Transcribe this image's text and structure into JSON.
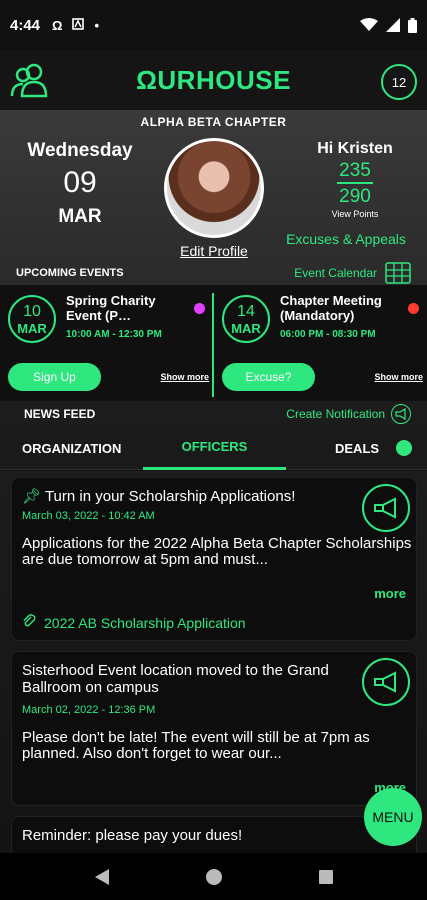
{
  "status_bar": {
    "time": "4:44",
    "icons": [
      "omega-icon",
      "nfc-icon",
      "dot-icon",
      "wifi-icon",
      "signal-icon",
      "battery-icon"
    ]
  },
  "header": {
    "logo": "ΩURHOUSE",
    "notification_count": "12"
  },
  "hero": {
    "chapter_name": "ALPHA BETA CHAPTER",
    "day_name": "Wednesday",
    "day_number": "09",
    "month": "MAR",
    "edit_profile": "Edit Profile",
    "greeting": "Hi Kristen",
    "points_earned": "235",
    "points_total": "290",
    "view_points": "View Points",
    "excuses_link": "Excuses & Appeals",
    "upcoming_title": "UPCOMING EVENTS",
    "event_calendar": "Event Calendar"
  },
  "events": [
    {
      "day": "10",
      "month": "MAR",
      "title": "Spring Charity Event (P…",
      "time": "10:00 AM - 12:30 PM",
      "dot_color": "#e040fb",
      "button": "Sign Up",
      "show_more": "Show more"
    },
    {
      "day": "14",
      "month": "MAR",
      "title": "Chapter Meeting (Mandatory)",
      "time": "06:00 PM - 08:30 PM",
      "dot_color": "#ff3b30",
      "button": "Excuse?",
      "show_more": "Show more"
    }
  ],
  "news": {
    "title": "NEWS FEED",
    "create_notification": "Create Notification"
  },
  "tabs": [
    {
      "label": "ORGANIZATION",
      "active": false
    },
    {
      "label": "OFFICERS",
      "active": true
    },
    {
      "label": "DEALS",
      "active": false
    }
  ],
  "posts": [
    {
      "title": "Turn in your Scholarship Applications!",
      "pinned": true,
      "date": "March 03, 2022 - 10:42 AM",
      "body": "Applications for the 2022 Alpha Beta Chapter Scholarships are due tomorrow at 5pm and must...",
      "more": "more",
      "attachment": "2022 AB Scholarship Application"
    },
    {
      "title": "Sisterhood Event location moved to the Grand Ballroom on campus",
      "pinned": false,
      "date": "March 02, 2022 - 12:36 PM",
      "body": "Please don't be late! The event will still be at 7pm as planned.  Also don't forget to wear our...",
      "more": "more"
    },
    {
      "title": "Reminder: please pay your dues!",
      "pinned": false
    }
  ],
  "menu_button": "MENU",
  "colors": {
    "accent": "#2ee87f",
    "background": "#161616",
    "card": "#0d0d0d"
  }
}
